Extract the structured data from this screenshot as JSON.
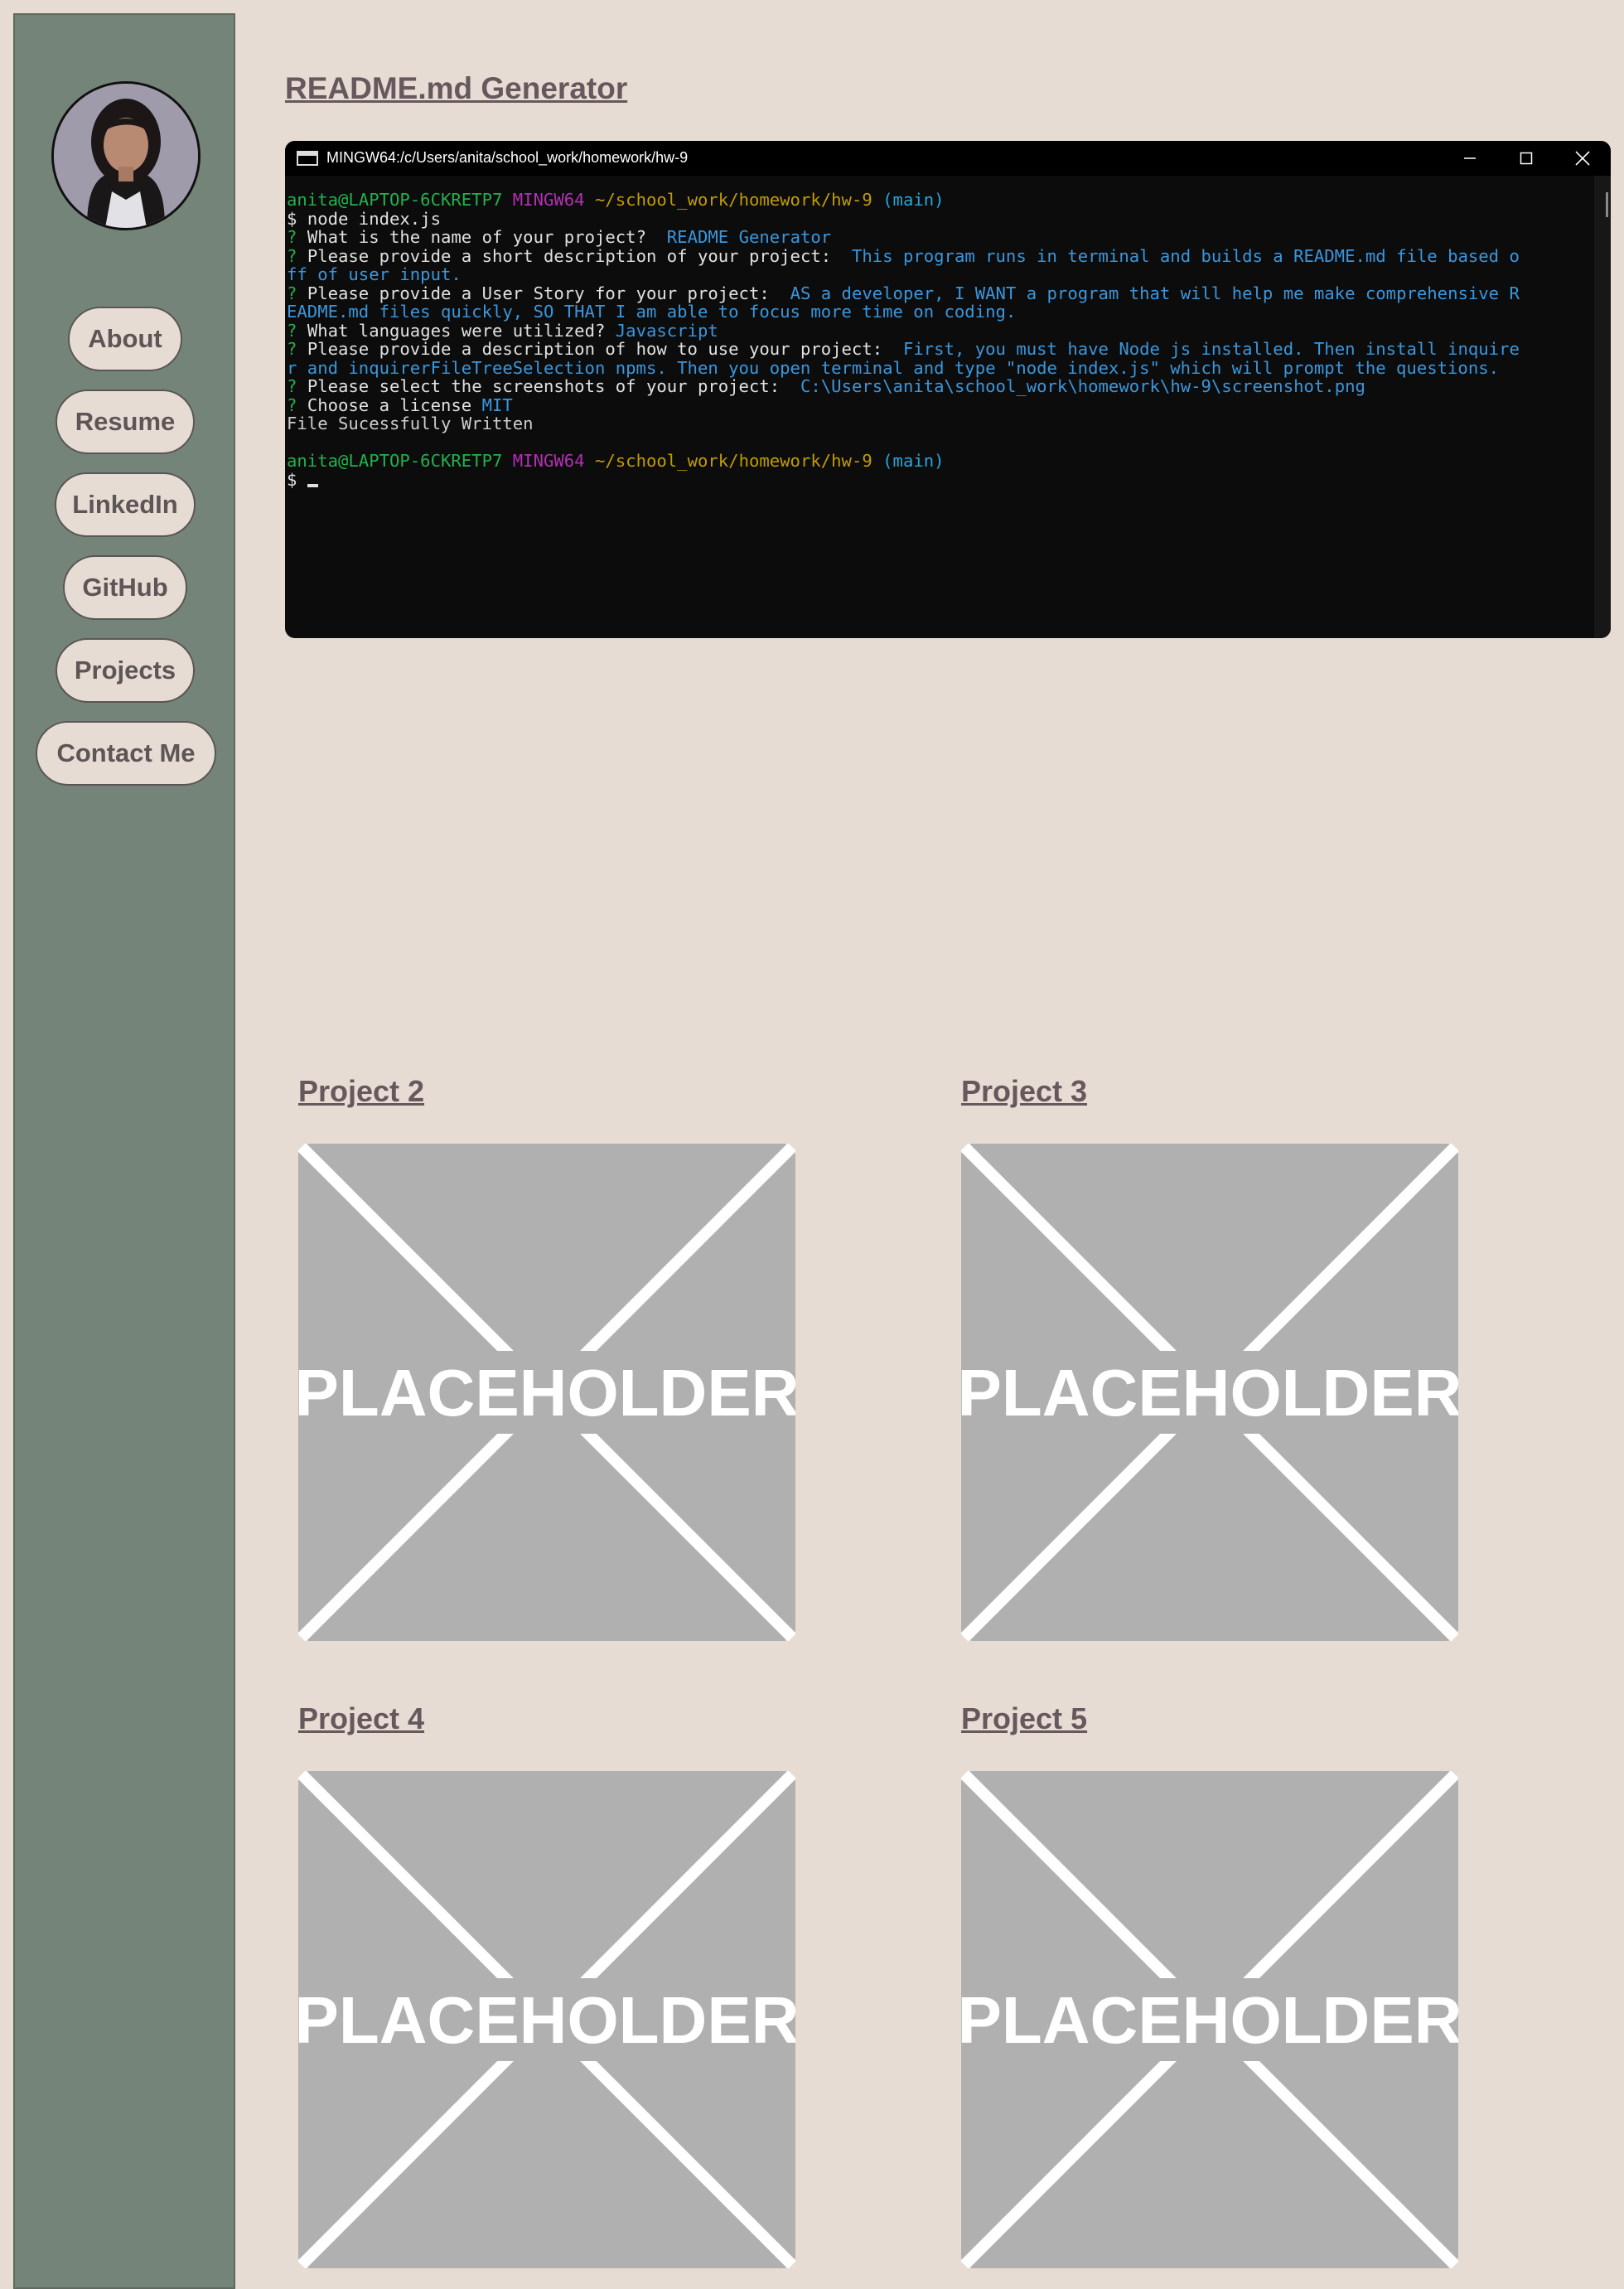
{
  "sidebar": {
    "avatar_alt": "profile photo",
    "nav": [
      {
        "label": "About"
      },
      {
        "label": "Resume"
      },
      {
        "label": "LinkedIn"
      },
      {
        "label": "GitHub"
      },
      {
        "label": "Projects"
      },
      {
        "label": "Contact Me"
      }
    ]
  },
  "main": {
    "featured_title": "README.md Generator",
    "terminal": {
      "window_title": "MINGW64:/c/Users/anita/school_work/homework/hw-9",
      "lines": [
        {
          "prompt_user": "anita@LAPTOP-6CKRETP7",
          "prompt_env": "MINGW64",
          "prompt_path": "~/school_work/homework/hw-9",
          "prompt_branch": "(main)"
        },
        {
          "dollar": "$",
          "command": "node index.js"
        },
        {
          "q": "What is the name of your project?",
          "a": "README Generator"
        },
        {
          "q": "Please provide a short description of your project:",
          "a": "This program runs in terminal and builds a README.md file based o"
        },
        {
          "cont": "ff of user input."
        },
        {
          "q": "Please provide a User Story for your project:",
          "a": "AS a developer, I WANT a program that will help me make comprehensive R"
        },
        {
          "cont": "EADME.md files quickly, SO THAT I am able to focus more time on coding."
        },
        {
          "q": "What languages were utilized?",
          "a": "Javascript"
        },
        {
          "q": "Please provide a description of how to use your project:",
          "a": "First, you must have Node js installed. Then install inquire"
        },
        {
          "cont": "r and inquirerFileTreeSelection npms. Then you open terminal and type \"node index.js\" which will prompt the questions."
        },
        {
          "q": "Please select the screenshots of your project:",
          "a": "C:\\Users\\anita\\school_work\\homework\\hw-9\\screenshot.png"
        },
        {
          "q": "Choose a license",
          "a": "MIT"
        },
        {
          "plain": "File Sucessfully Written"
        },
        {
          "blank": ""
        },
        {
          "prompt_user": "anita@LAPTOP-6CKRETP7",
          "prompt_env": "MINGW64",
          "prompt_path": "~/school_work/homework/hw-9",
          "prompt_branch": "(main)"
        },
        {
          "dollar": "$",
          "command": ""
        }
      ],
      "question_mark": "?"
    },
    "projects": [
      {
        "title": "Project 2",
        "image_text": "PLACEHOLDER"
      },
      {
        "title": "Project 3",
        "image_text": "PLACEHOLDER"
      },
      {
        "title": "Project 4",
        "image_text": "PLACEHOLDER"
      },
      {
        "title": "Project 5",
        "image_text": "PLACEHOLDER"
      }
    ]
  },
  "colors": {
    "page_bg": "#e6dcd3",
    "sidebar_bg": "#758478",
    "link_text": "#66585d",
    "placeholder_bg": "#b0b0b0"
  }
}
